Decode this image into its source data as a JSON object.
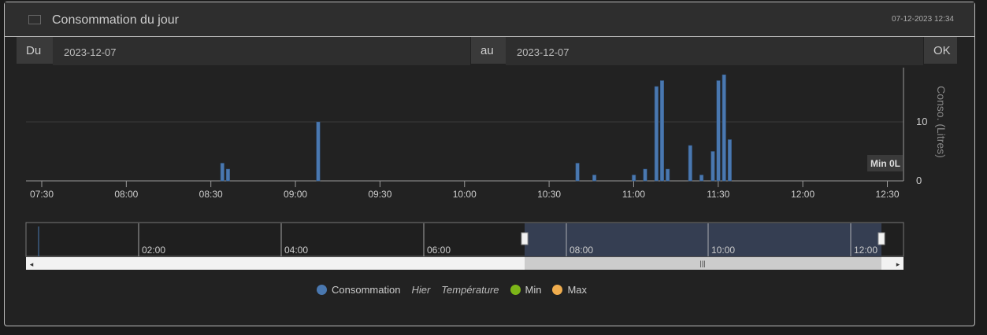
{
  "header": {
    "title": "Consommation du jour",
    "timestamp": "07-12-2023 12:34",
    "icon": "bar-chart-icon"
  },
  "form": {
    "from_label": "Du",
    "from_value": "2023-12-07",
    "to_label": "au",
    "to_value": "2023-12-07",
    "ok_label": "OK"
  },
  "chart_data": {
    "type": "bar",
    "series": [
      {
        "name": "Consommation",
        "color": "#4a78b0",
        "x": [
          "08:34",
          "08:36",
          "09:08",
          "10:40",
          "10:46",
          "11:00",
          "11:04",
          "11:08",
          "11:10",
          "11:12",
          "11:20",
          "11:24",
          "11:28",
          "11:30",
          "11:32",
          "11:34"
        ],
        "values": [
          3,
          2,
          10,
          3,
          1,
          1,
          2,
          16,
          17,
          2,
          6,
          1,
          5,
          17,
          18,
          7
        ]
      }
    ],
    "xticks": [
      "07:30",
      "08:00",
      "08:30",
      "09:00",
      "09:30",
      "10:00",
      "10:30",
      "11:00",
      "11:30",
      "12:00",
      "12:30"
    ],
    "yticks": [
      0,
      10
    ],
    "ylabel": "Conso. (Litres)",
    "ylim": [
      0,
      19
    ],
    "annotation": "Min 0L",
    "navigator_ticks": [
      "02:00",
      "04:00",
      "06:00",
      "08:00",
      "10:00",
      "12:00"
    ],
    "legend": [
      {
        "name": "Consommation",
        "color": "#4a78b0"
      },
      {
        "name": "Hier",
        "color": null
      },
      {
        "name": "Température",
        "color": null
      },
      {
        "name": "Min",
        "color": "#7cb518"
      },
      {
        "name": "Max",
        "color": "#f0ad4e"
      }
    ]
  }
}
